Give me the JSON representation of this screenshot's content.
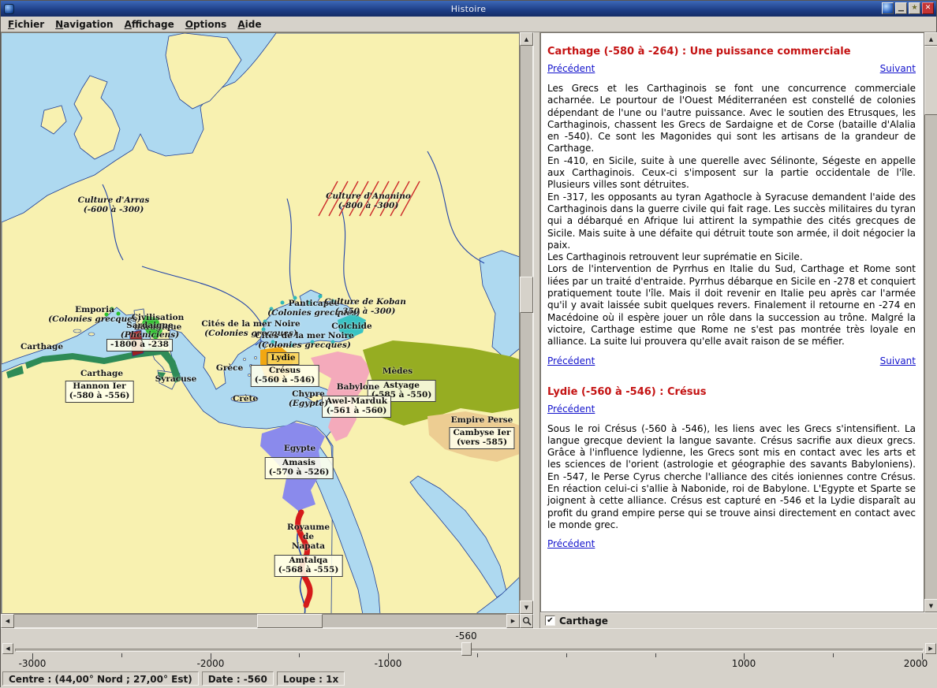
{
  "window": {
    "title": "Histoire",
    "menu": [
      "Fichier",
      "Navigation",
      "Affichage",
      "Options",
      "Aide"
    ]
  },
  "icons": {
    "arrow_up": "▲",
    "arrow_down": "▼",
    "arrow_left": "◀",
    "arrow_right": "▶",
    "check": "✔",
    "close": "✕",
    "star": "★",
    "minimize": "▁"
  },
  "map": {
    "colors": {
      "sea": "#aed9f0",
      "land": "#f8f1b0",
      "coast": "#1f3e96",
      "carthage": "#2e8b57",
      "etrurie": "#2bc12b",
      "sardaigne": "#9c2020",
      "lydie": "#f2a711",
      "babylonie": "#f4aabb",
      "medes": "#96ad22",
      "colchide": "#38c3c3",
      "colonies_grecques": "#2fb9b9",
      "empire_perse": "#edcd92",
      "egypte": "#8a8aec",
      "napata": "#d51a1a",
      "hachures_ananino": "#cc2a2a"
    },
    "labels": {
      "arras": {
        "l1": "Culture d'Arras",
        "l2": "(-600 à -300)"
      },
      "ananino": {
        "l1": "Culture d'Ananino",
        "l2": "(-800 à -300)"
      },
      "emporia": {
        "l1": "Emporia",
        "l2": "(Colonies grecques)"
      },
      "civilisation": {
        "l1": "Civilisation",
        "l2": "nuragique"
      },
      "sardaigne": {
        "l1": "Sardaigne",
        "l2": "(Phéniciens)",
        "l3": "-1800 à -238"
      },
      "carthage_ouest": {
        "l1": "Carthage"
      },
      "carthage": {
        "l1": "Carthage",
        "l2": "Hannon Ier",
        "l3": "(-580 à -556)"
      },
      "syracuse": {
        "l1": "Syracuse"
      },
      "grece": {
        "l1": "Grèce"
      },
      "crete": {
        "l1": "Crète"
      },
      "cites_mer_noire_ouest": {
        "l1": "Cités de la mer Noire",
        "l2": "(Colonies grecques)"
      },
      "panticapee": {
        "l1": "Panticapée",
        "l2": "(Colonies grecques)"
      },
      "koban": {
        "l1": "Culture de Koban",
        "l2": "(-350 à -300)"
      },
      "colchide": {
        "l1": "Colchide"
      },
      "cites_mer_noire_sud": {
        "l1": "Cités de la mer Noire",
        "l2": "(Colonies grecques)"
      },
      "lydie": {
        "l1": "Lydie"
      },
      "cresus": {
        "l1": "Crésus",
        "l2": "(-560 à -546)"
      },
      "medes": {
        "l1": "Mèdes"
      },
      "astyage": {
        "l1": "Astyage",
        "l2": "(-585 à -550)"
      },
      "babylone": {
        "l1": "Babylone"
      },
      "awel_marduk": {
        "l1": "Awel-Marduk",
        "l2": "(-561 à -560)"
      },
      "chypre": {
        "l1": "Chypre",
        "l2": "(Egypte)"
      },
      "empire_perse": {
        "l1": "Empire Perse",
        "l2": "Cambyse Ier",
        "l3": "(vers -585)"
      },
      "egypte": {
        "l1": "Egypte"
      },
      "amasis": {
        "l1": "Amasis",
        "l2": "(-570 à -526)"
      },
      "napata": {
        "l1": "Royaume",
        "l2": "de",
        "l3": "Napata"
      },
      "amtalqa": {
        "l1": "Amtalqa",
        "l2": "(-568 à -555)"
      }
    }
  },
  "panel": {
    "nav_prev": "Précédent",
    "nav_next": "Suivant",
    "sections": [
      {
        "title": "Carthage (-580 à -264) : Une puissance commerciale",
        "paragraphs": [
          "Les Grecs et les Carthaginois se font une concurrence commerciale acharnée. Le pourtour de l'Ouest Méditerranéen est constellé de colonies dépendant de l'une ou l'autre puissance. Avec le soutien des Etrusques, les Carthaginois, chassent les Grecs de Sardaigne et de Corse (bataille d'Alalia en -540). Ce sont les Magonides qui sont les artisans de la grandeur de Carthage.",
          "En -410, en Sicile, suite à une querelle avec Sélinonte, Ségeste en appelle aux Carthaginois. Ceux-ci s'imposent sur la partie occidentale de l'île. Plusieurs villes sont détruites.",
          "En -317, les opposants au tyran Agathocle à Syracuse demandent l'aide des Carthaginois dans la guerre civile qui fait rage. Les succès militaires du tyran qui a débarqué en Afrique lui attirent la sympathie des cités grecques de Sicile. Mais suite à une défaite qui détruit toute son armée, il doit négocier la paix.",
          "Les Carthaginois retrouvent leur suprématie en Sicile.",
          "Lors de l'intervention de Pyrrhus en Italie du Sud, Carthage et Rome sont liées par un traité d'entraide. Pyrrhus débarque en Sicile en -278 et conquiert pratiquement toute l'île. Mais il doit revenir en Italie peu après car l'armée qu'il y avait laissée subit quelques revers. Finalement il retourne en -274 en Macédoine où il espère jouer un rôle dans la succession au trône. Malgré la victoire, Carthage estime que Rome ne s'est pas montrée très loyale en alliance. La suite lui prouvera qu'elle avait raison de se méfier."
        ]
      },
      {
        "title": "Lydie (-560 à -546) : Crésus",
        "paragraphs": [
          "Sous le roi Crésus (-560 à -546), les liens avec les Grecs s'intensifient. La langue grecque devient la langue savante. Crésus sacrifie aux dieux grecs. Grâce à l'influence lydienne, les Grecs sont mis en contact avec les arts et les sciences de l'orient (astrologie et géographie des savants Babyloniens). En -547, le Perse Cyrus cherche l'alliance des cités ioniennes contre Crésus. En réaction celui-ci s'allie à Nabonide, roi de Babylone. L'Egypte et Sparte se joignent à cette alliance. Crésus est capturé en -546 et la Lydie disparaît au profit du grand empire perse qui se trouve ainsi directement en contact avec le monde grec."
        ]
      }
    ],
    "checkbox_label": "Carthage"
  },
  "timeline": {
    "current": "-560",
    "ticks": [
      "-3000",
      "-2000",
      "-1000",
      "1000",
      "2000"
    ]
  },
  "statusbar": {
    "center": "Centre : (44,00° Nord ; 27,00° Est)",
    "date": "Date : -560",
    "loupe": "Loupe : 1x"
  }
}
